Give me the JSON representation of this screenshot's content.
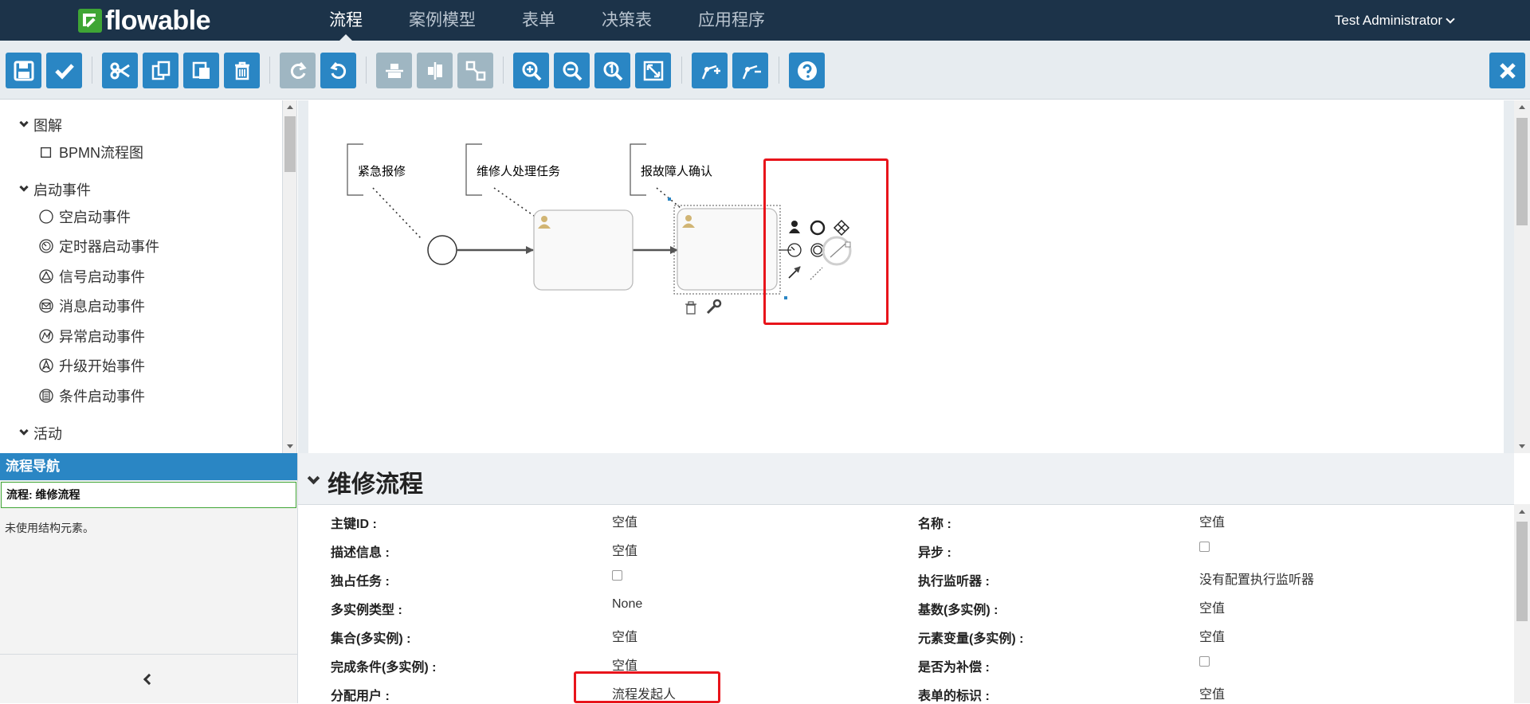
{
  "app": {
    "logo_text": "flowable",
    "user": "Test Administrator"
  },
  "nav": {
    "tabs": [
      {
        "label": "流程",
        "active": true
      },
      {
        "label": "案例模型",
        "active": false
      },
      {
        "label": "表单",
        "active": false
      },
      {
        "label": "决策表",
        "active": false
      },
      {
        "label": "应用程序",
        "active": false
      }
    ]
  },
  "toolbar": {
    "buttons": [
      {
        "icon": "save-icon",
        "enabled": true
      },
      {
        "icon": "validate-icon",
        "enabled": true
      },
      {
        "icon": "cut-icon",
        "enabled": true
      },
      {
        "icon": "copy-icon",
        "enabled": true
      },
      {
        "icon": "paste-icon",
        "enabled": true
      },
      {
        "icon": "delete-icon",
        "enabled": true
      },
      {
        "icon": "redo-icon",
        "enabled": false
      },
      {
        "icon": "undo-icon",
        "enabled": true
      },
      {
        "icon": "align-horizontal-icon",
        "enabled": false
      },
      {
        "icon": "align-vertical-icon",
        "enabled": false
      },
      {
        "icon": "same-size-icon",
        "enabled": false
      },
      {
        "icon": "zoom-in-icon",
        "enabled": true
      },
      {
        "icon": "zoom-out-icon",
        "enabled": true
      },
      {
        "icon": "zoom-actual-icon",
        "enabled": true
      },
      {
        "icon": "zoom-fit-icon",
        "enabled": true
      },
      {
        "icon": "add-bendpoint-icon",
        "enabled": true
      },
      {
        "icon": "remove-bendpoint-icon",
        "enabled": true
      },
      {
        "icon": "help-icon",
        "enabled": true
      }
    ],
    "close": {
      "icon": "close-icon"
    }
  },
  "palette": {
    "groups": [
      {
        "title": "图解",
        "items": [
          {
            "label": "BPMN流程图",
            "icon": "square-icon"
          }
        ]
      },
      {
        "title": "启动事件",
        "items": [
          {
            "label": "空启动事件",
            "icon": "none-start-event-icon"
          },
          {
            "label": "定时器启动事件",
            "icon": "timer-start-event-icon"
          },
          {
            "label": "信号启动事件",
            "icon": "signal-start-event-icon"
          },
          {
            "label": "消息启动事件",
            "icon": "message-start-event-icon"
          },
          {
            "label": "异常启动事件",
            "icon": "error-start-event-icon"
          },
          {
            "label": "升级开始事件",
            "icon": "escalation-start-event-icon"
          },
          {
            "label": "条件启动事件",
            "icon": "conditional-start-event-icon"
          }
        ]
      },
      {
        "title": "活动",
        "items": []
      }
    ]
  },
  "canvas": {
    "annotations": [
      "紧急报修",
      "维修人处理任务",
      "报故障人确认"
    ]
  },
  "flow_nav": {
    "title": "流程导航",
    "selected": "流程: 维修流程",
    "empty_text": "未使用结构元素。"
  },
  "properties": {
    "title": "维修流程",
    "rows": [
      {
        "label": "主键ID :",
        "value": "空值",
        "type": "text"
      },
      {
        "label": "名称 :",
        "value": "空值",
        "type": "text"
      },
      {
        "label": "描述信息 :",
        "value": "空值",
        "type": "text"
      },
      {
        "label": "异步 :",
        "value": "",
        "type": "checkbox"
      },
      {
        "label": "独占任务 :",
        "value": "",
        "type": "checkbox"
      },
      {
        "label": "执行监听器 :",
        "value": "没有配置执行监听器",
        "type": "text"
      },
      {
        "label": "多实例类型 :",
        "value": "None",
        "type": "text"
      },
      {
        "label": "基数(多实例) :",
        "value": "空值",
        "type": "text"
      },
      {
        "label": "集合(多实例) :",
        "value": "空值",
        "type": "text"
      },
      {
        "label": "元素变量(多实例) :",
        "value": "空值",
        "type": "text"
      },
      {
        "label": "完成条件(多实例) :",
        "value": "空值",
        "type": "text"
      },
      {
        "label": "是否为补偿 :",
        "value": "",
        "type": "checkbox"
      },
      {
        "label": "分配用户 :",
        "value": "流程发起人",
        "type": "text"
      },
      {
        "label": "表单的标识 :",
        "value": "空值",
        "type": "text"
      }
    ]
  },
  "colors": {
    "navbar": "#1c3349",
    "primary": "#2a86c4",
    "highlight": "#e8141b",
    "brand_green": "#3fa535"
  }
}
